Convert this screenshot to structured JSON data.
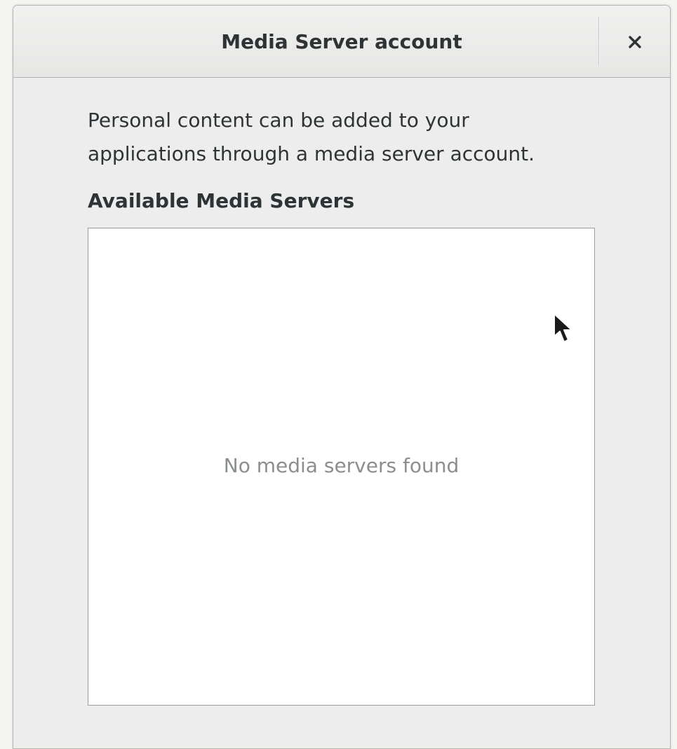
{
  "dialog": {
    "title": "Media Server account",
    "close_icon": "close-icon",
    "description_lines": [
      "Personal content can be added to your",
      "applications through a media server account."
    ],
    "section_label": "Available Media Servers",
    "servers": [],
    "empty_message": "No media servers found"
  },
  "pointer_icon": "mouse-pointer-icon",
  "colors": {
    "text": "#2e3436",
    "muted_text": "#8b8e8f",
    "dialog_bg": "#ededed",
    "list_bg": "#ffffff",
    "border": "#9d9d9b"
  }
}
